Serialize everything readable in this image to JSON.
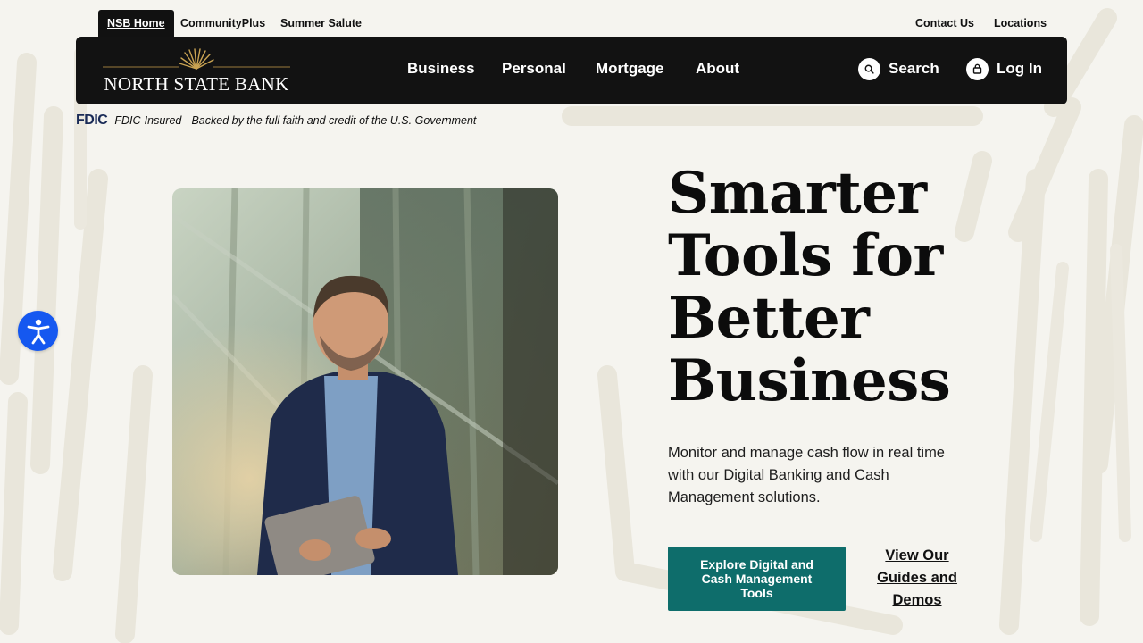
{
  "util_nav": {
    "tabs": [
      {
        "label": "NSB Home",
        "active": true
      },
      {
        "label": "CommunityPlus",
        "active": false
      },
      {
        "label": "Summer Salute",
        "active": false
      }
    ],
    "right_links": [
      "Contact Us",
      "Locations"
    ]
  },
  "header": {
    "logo_text": "NORTH STATE BANK",
    "nav": [
      "Business",
      "Personal",
      "Mortgage",
      "About"
    ],
    "search_label": "Search",
    "login_label": "Log In"
  },
  "fdic": {
    "logo": "FDIC",
    "text": "FDIC-Insured - Backed by the full faith and credit of the U.S. Government"
  },
  "hero": {
    "title": "Smarter Tools for Better Business",
    "subtitle": "Monitor and manage cash flow in real time with our Digital Banking and Cash Management solutions.",
    "primary_cta": "Explore Digital and Cash Management Tools",
    "secondary_cta": "View Our Guides and Demos"
  },
  "icons": {
    "search": "search-icon",
    "login": "lock-icon",
    "accessibility": "accessibility-icon",
    "logo_mark": "wheat-sheaf-icon"
  },
  "colors": {
    "background": "#f5f4ef",
    "header": "#121212",
    "cta": "#0e6d6b",
    "accessibility": "#1558f0",
    "fdic_logo": "#1a2b57"
  }
}
